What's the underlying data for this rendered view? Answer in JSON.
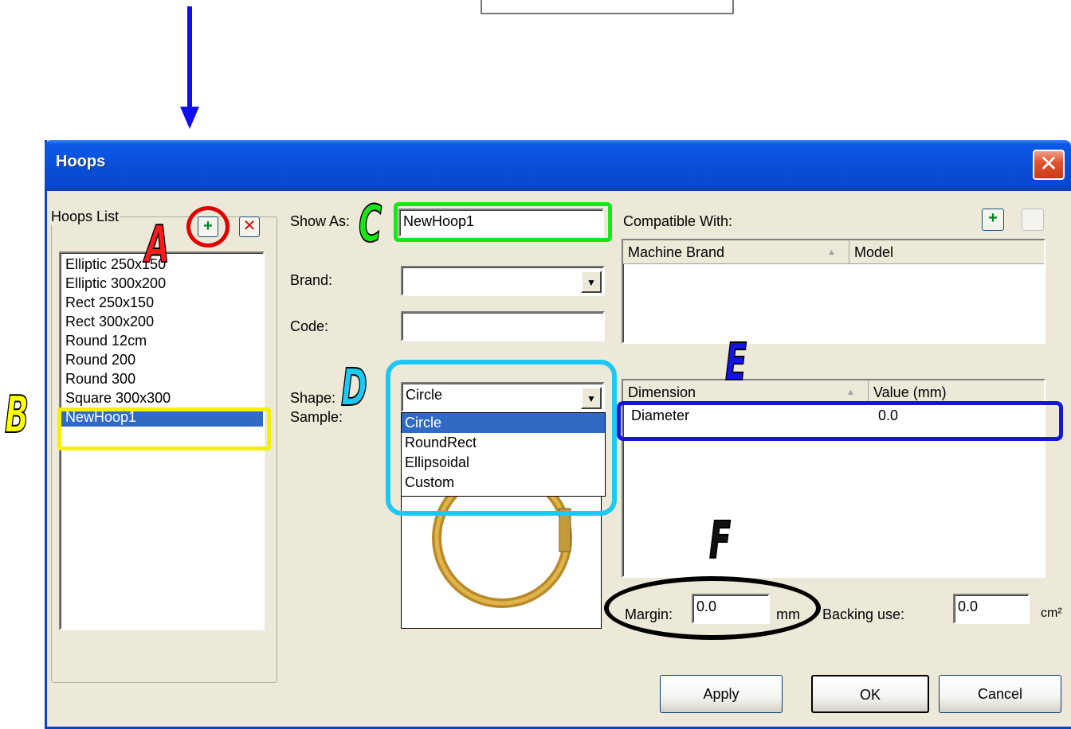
{
  "window": {
    "title": "Hoops"
  },
  "hoops_list": {
    "legend": "Hoops List",
    "items": [
      "Elliptic 250x150",
      "Elliptic 300x200",
      "Rect 250x150",
      "Rect 300x200",
      "Round 12cm",
      "Round 200",
      "Round 300",
      "Square 300x300",
      "NewHoop1"
    ],
    "selected": "NewHoop1"
  },
  "form": {
    "show_as_label": "Show As:",
    "show_as_value": "NewHoop1",
    "brand_label": "Brand:",
    "brand_value": "",
    "code_label": "Code:",
    "code_value": "",
    "shape_label": "Shape:",
    "shape_value": "Circle",
    "shape_options": [
      "Circle",
      "RoundRect",
      "Ellipsoidal",
      "Custom"
    ],
    "sample_label": "Sample:"
  },
  "compatible": {
    "label": "Compatible With:",
    "columns": [
      "Machine Brand",
      "Model"
    ],
    "rows": []
  },
  "dimensions": {
    "columns": [
      "Dimension",
      "Value (mm)"
    ],
    "rows": [
      {
        "dimension": "Diameter",
        "value": "0.0"
      }
    ]
  },
  "margin": {
    "label": "Margin:",
    "value": "0.0",
    "unit": "mm"
  },
  "backing": {
    "label": "Backing use:",
    "value": "0.0",
    "unit": "cm²"
  },
  "buttons": {
    "apply": "Apply",
    "ok": "OK",
    "cancel": "Cancel"
  },
  "annotations": {
    "A": {
      "letter": "A",
      "color": "#ff1a1a",
      "ring_color": "#e00000"
    },
    "B": {
      "letter": "B",
      "color": "#ffff00",
      "ring_color": "#f5f000"
    },
    "C": {
      "letter": "C",
      "color": "#19e619",
      "ring_color": "#19e619"
    },
    "D": {
      "letter": "D",
      "color": "#1ec8f5",
      "ring_color": "#1ec8f5"
    },
    "E": {
      "letter": "E",
      "color": "#1515dd",
      "ring_color": "#1515dd"
    },
    "F": {
      "letter": "F",
      "color": "#111111",
      "ring_color": "#000000"
    }
  },
  "colors": {
    "arrow": "#1010ee",
    "titlebar": "#0a4fd8",
    "selection": "#316ac5",
    "dialog_bg": "#ece9d8"
  },
  "icons": [
    "add-icon",
    "delete-icon",
    "close-icon",
    "dropdown-arrow-icon",
    "sort-arrow-icon",
    "hoop-sample-icon"
  ]
}
